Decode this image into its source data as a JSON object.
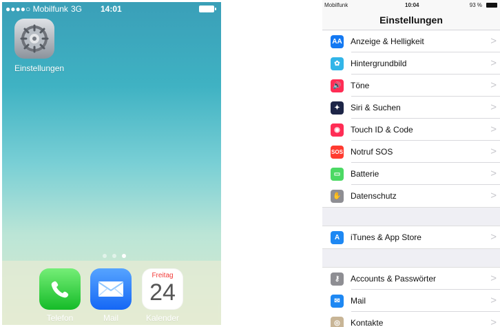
{
  "left": {
    "status": {
      "carrier": "●●●●○ Mobilfunk",
      "network": "3G",
      "time": "14:01"
    },
    "apps": {
      "settings": "Einstellungen"
    },
    "dock": [
      {
        "label": "Telefon"
      },
      {
        "label": "Mail"
      },
      {
        "label": "Kalender",
        "day": "Freitag",
        "date": "24"
      }
    ]
  },
  "right": {
    "status": {
      "carrier": "Mobilfunk",
      "time": "10:04",
      "battery": "93 %"
    },
    "title": "Einstellungen",
    "groups": [
      {
        "items": [
          {
            "label": "Anzeige & Helligkeit",
            "icon": "display-brightness-icon",
            "color": "#1479f2"
          },
          {
            "label": "Hintergrundbild",
            "icon": "wallpaper-icon",
            "color": "#32b5e8"
          },
          {
            "label": "Töne",
            "icon": "sound-icon",
            "color": "#ff2d55"
          },
          {
            "label": "Siri & Suchen",
            "icon": "siri-icon",
            "color": "#1d2547"
          },
          {
            "label": "Touch ID & Code",
            "icon": "fingerprint-icon",
            "color": "#ff2d55"
          },
          {
            "label": "Notruf SOS",
            "icon": "sos-icon",
            "color": "#ff3b30"
          },
          {
            "label": "Batterie",
            "icon": "battery-icon",
            "color": "#4cd964"
          },
          {
            "label": "Datenschutz",
            "icon": "privacy-hand-icon",
            "color": "#8e8e93"
          }
        ]
      },
      {
        "items": [
          {
            "label": "iTunes & App Store",
            "icon": "app-store-icon",
            "color": "#1e88f3"
          }
        ]
      },
      {
        "items": [
          {
            "label": "Accounts & Passwörter",
            "icon": "key-icon",
            "color": "#8e8e93"
          },
          {
            "label": "Mail",
            "icon": "mail-icon",
            "color": "#1e88f3"
          },
          {
            "label": "Kontakte",
            "icon": "contacts-icon",
            "color": "#c8b596"
          }
        ]
      }
    ],
    "chevron": ">"
  }
}
